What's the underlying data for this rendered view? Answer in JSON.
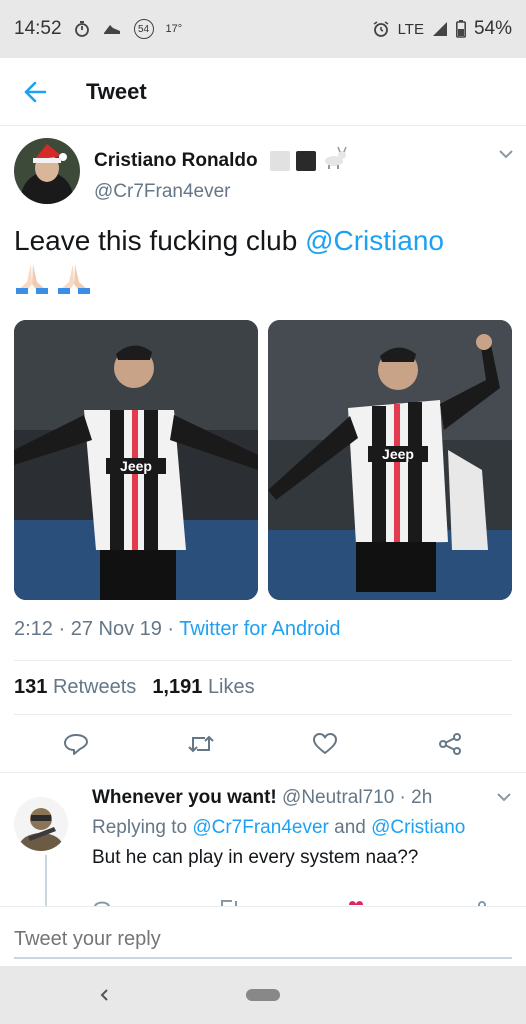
{
  "status_bar": {
    "time": "14:52",
    "badge_count": "54",
    "temperature": "17°",
    "network": "LTE",
    "battery": "54%"
  },
  "header": {
    "title": "Tweet"
  },
  "tweet": {
    "author_name": "Cristiano Ronaldo",
    "author_handle": "@Cr7Fran4ever",
    "text_prefix": "Leave this fucking club ",
    "text_mention": "@Cristiano",
    "timestamp": "2:12 · 27 Nov 19 · ",
    "source": "Twitter for Android",
    "retweets_count": "131",
    "retweets_label": "Retweets",
    "likes_count": "1,191",
    "likes_label": "Likes"
  },
  "reply": {
    "name": "Whenever you want!",
    "meta": " @Neutral710 · 2h",
    "replying_prefix": "Replying to ",
    "replying_handle1": "@Cr7Fran4ever",
    "replying_and": " and ",
    "replying_handle2": "@Cristiano",
    "text": "But he can play in every system naa??"
  },
  "compose": {
    "placeholder": "Tweet your reply"
  },
  "colors": {
    "accent": "#1da1f2",
    "secondary_text": "#657786"
  }
}
